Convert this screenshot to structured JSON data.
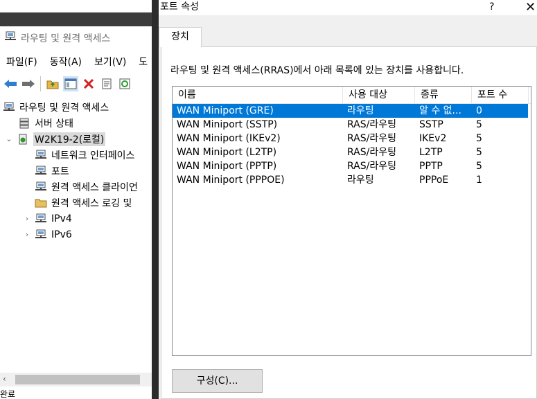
{
  "mmc": {
    "title": "라우팅 및 원격 액세스",
    "menu": [
      "파일(F)",
      "동작(A)",
      "보기(V)",
      "도"
    ],
    "tree": [
      {
        "label": "라우팅 및 원격 액세스",
        "icon": "server-icon",
        "level": 0,
        "expander": ""
      },
      {
        "label": "서버 상태",
        "icon": "server-status-icon",
        "level": 1,
        "expander": ""
      },
      {
        "label": "W2K19-2(로컬)",
        "icon": "server-local-icon",
        "level": 1,
        "expander": "⌄"
      },
      {
        "label": "네트워크 인터페이스",
        "icon": "network-interface-icon",
        "level": 2,
        "expander": ""
      },
      {
        "label": "포트",
        "icon": "ports-icon",
        "level": 2,
        "expander": ""
      },
      {
        "label": "원격 액세스 클라이언",
        "icon": "remote-clients-icon",
        "level": 2,
        "expander": ""
      },
      {
        "label": "원격 액세스 로깅 및",
        "icon": "folder-icon",
        "level": 2,
        "expander": ""
      },
      {
        "label": "IPv4",
        "icon": "ipv4-icon",
        "level": 2,
        "expander": "›"
      },
      {
        "label": "IPv6",
        "icon": "ipv6-icon",
        "level": 2,
        "expander": "›"
      }
    ],
    "status_text": "완료"
  },
  "dialog": {
    "title": "포트 속성",
    "help": "?",
    "close": "✕",
    "tab": "장치",
    "description": "라우팅 및 원격 액세스(RRAS)에서 아래 목록에 있는 장치를 사용합니다.",
    "columns": [
      "이름",
      "사용 대상",
      "종류",
      "포트 수"
    ],
    "rows": [
      {
        "name": "WAN Miniport (GRE)",
        "used_by": "라우팅",
        "type": "알 수 없...",
        "ports": "0",
        "selected": true
      },
      {
        "name": "WAN Miniport (SSTP)",
        "used_by": "RAS/라우팅",
        "type": "SSTP",
        "ports": "5",
        "selected": false
      },
      {
        "name": "WAN Miniport (IKEv2)",
        "used_by": "RAS/라우팅",
        "type": "IKEv2",
        "ports": "5",
        "selected": false
      },
      {
        "name": "WAN Miniport (L2TP)",
        "used_by": "RAS/라우팅",
        "type": "L2TP",
        "ports": "5",
        "selected": false
      },
      {
        "name": "WAN Miniport (PPTP)",
        "used_by": "RAS/라우팅",
        "type": "PPTP",
        "ports": "5",
        "selected": false
      },
      {
        "name": "WAN Miniport (PPPOE)",
        "used_by": "라우팅",
        "type": "PPPoE",
        "ports": "1",
        "selected": false
      }
    ],
    "configure_button": "구성(C)..."
  },
  "colors": {
    "selection": "#0078d7",
    "title_band": "#3c3c3c"
  }
}
